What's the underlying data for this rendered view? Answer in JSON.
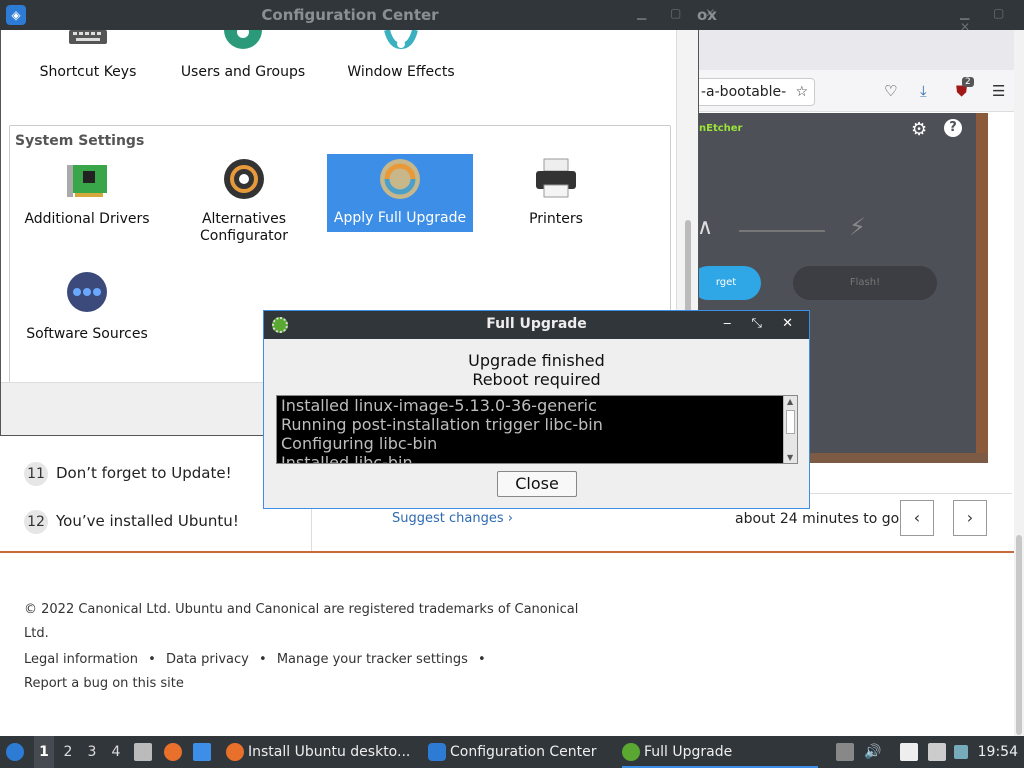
{
  "topbar": {
    "cc_title": "Configuration Center",
    "ff_title_fragment": "ox"
  },
  "config_center": {
    "top_items": [
      {
        "label": "Shortcut Keys",
        "icon": "keyboard-icon"
      },
      {
        "label": "Users and Groups",
        "icon": "users-icon"
      },
      {
        "label": "Window Effects",
        "icon": "window-effects-icon"
      }
    ],
    "system_settings_title": "System Settings",
    "system_items": [
      {
        "label": "Additional Drivers",
        "icon": "drivers-icon"
      },
      {
        "label": "Alternatives Configurator",
        "icon": "alternatives-icon"
      },
      {
        "label": "Apply Full Upgrade",
        "icon": "upgrade-icon",
        "selected": true
      },
      {
        "label": "Printers",
        "icon": "printer-icon"
      },
      {
        "label": "Software Sources",
        "icon": "software-sources-icon"
      }
    ],
    "alternatives_line1": "Alternatives",
    "alternatives_line2": "Configurator"
  },
  "firefox": {
    "url_fragment": "-a-bootable-",
    "extension_badge": "2"
  },
  "etcher": {
    "brand_fragment": "nEtcher",
    "target_button": "rget",
    "flash_button": "Flash!"
  },
  "tutorial": {
    "steps": [
      {
        "num": "11",
        "label": "Don’t forget to Update!"
      },
      {
        "num": "12",
        "label": "You’ve installed Ubuntu!"
      }
    ],
    "suggest_changes": "Suggest changes ›",
    "time_to_go": "about 24 minutes to go",
    "prev": "‹",
    "next": "›"
  },
  "footer": {
    "copyright_line1": "© 2022 Canonical Ltd. Ubuntu and Canonical are registered trademarks of Canonical",
    "copyright_line2": "Ltd.",
    "legal": "Legal information",
    "privacy": "Data privacy",
    "tracker": "Manage your tracker settings",
    "bullet": "•",
    "report_bug": "Report a bug on this site"
  },
  "dialog": {
    "title": "Full Upgrade",
    "message_line1": "Upgrade finished",
    "message_line2": "Reboot required",
    "log_lines": [
      "Installed linux-image-5.13.0-36-generic",
      "Running post-installation trigger libc-bin",
      "Configuring libc-bin",
      "Installed libc-bin"
    ],
    "close_button": "Close"
  },
  "taskbar": {
    "workspaces": [
      "1",
      "2",
      "3",
      "4"
    ],
    "tasks": [
      {
        "label": "Install Ubuntu deskto...",
        "icon": "firefox-icon"
      },
      {
        "label": "Configuration Center",
        "icon": "config-center-icon"
      },
      {
        "label": "Full Upgrade",
        "icon": "gear-icon",
        "active": true
      }
    ],
    "clock": "19:54"
  }
}
